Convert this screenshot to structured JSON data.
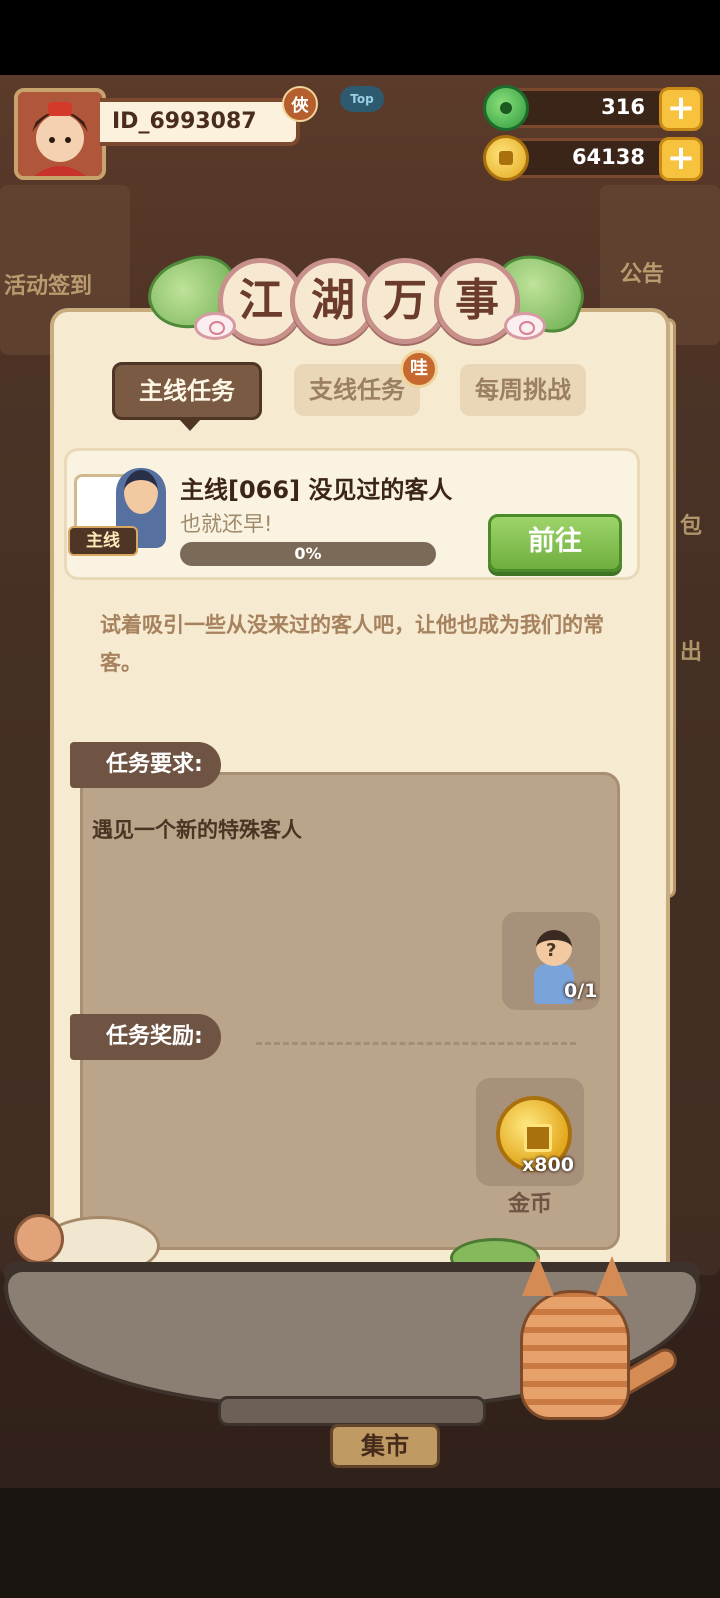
{
  "hud": {
    "player_id": "ID_6993087",
    "vip_badge": "俠",
    "top_badge": "Top",
    "jade_amount": "316",
    "coin_amount": "64138"
  },
  "side": {
    "left_event": "活动签到",
    "right_notice": "公告",
    "right_edge_1": "包",
    "right_edge_2": "出"
  },
  "panel": {
    "title_chars": [
      "江",
      "湖",
      "万",
      "事"
    ],
    "tabs": [
      {
        "label": "主线任务",
        "active": true
      },
      {
        "label": "支线任务",
        "active": false
      },
      {
        "label": "每周挑战",
        "active": false
      }
    ],
    "tab_badge": "哇"
  },
  "quest": {
    "tag": "主线",
    "title": "主线[066] 没见过的客人",
    "subtitle": "也就还早!",
    "progress_percent": 0,
    "progress_label": "0%",
    "go_button": "前往",
    "description": "试着吸引一些从没来过的客人吧，让他也成为我们的常客。"
  },
  "requirement": {
    "label": "任务要求:",
    "text": "遇见一个新的特殊客人",
    "count": "0/1"
  },
  "reward": {
    "label": "任务奖励:",
    "amount": "x800",
    "name": "金币"
  },
  "bottom": {
    "market_label": "集市"
  },
  "colors": {
    "panel_bg": "#f6ead0",
    "go_button": "#7fbf4d",
    "tab_active": "#7a5a43",
    "box_bg": "#baa58a"
  }
}
